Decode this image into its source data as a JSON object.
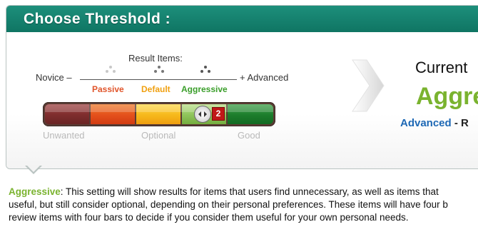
{
  "header": {
    "title": "Choose  Threshold :"
  },
  "scale": {
    "result_items_label": "Result Items:",
    "left_label": "Novice –",
    "right_label": "+ Advanced",
    "levels": [
      {
        "label": "Passive",
        "color": "#e0542a"
      },
      {
        "label": "Default",
        "color": "#f0a010"
      },
      {
        "label": "Aggressive",
        "color": "#3a9e2a"
      }
    ]
  },
  "slider": {
    "position_label": "2",
    "segments": 5,
    "selected_segment": 4,
    "colors": [
      "#7e2d2d",
      "#e4501c",
      "#f6b81b",
      "#8ec45a",
      "#1c7d2c"
    ],
    "sub_labels": [
      "Unwanted",
      "Optional",
      "Good"
    ]
  },
  "current": {
    "title": "Current",
    "value": "Aggre",
    "mode": "Advanced",
    "separator": "- R"
  },
  "description": {
    "term": "Aggressive",
    "line1_rest": ": This setting will show results for items that users find unnecessary, as well as items that",
    "line2": "useful, but still consider optional, depending on their personal preferences. These items will have four b",
    "line3": "review items with four bars to decide if you consider them useful for your own personal needs."
  }
}
